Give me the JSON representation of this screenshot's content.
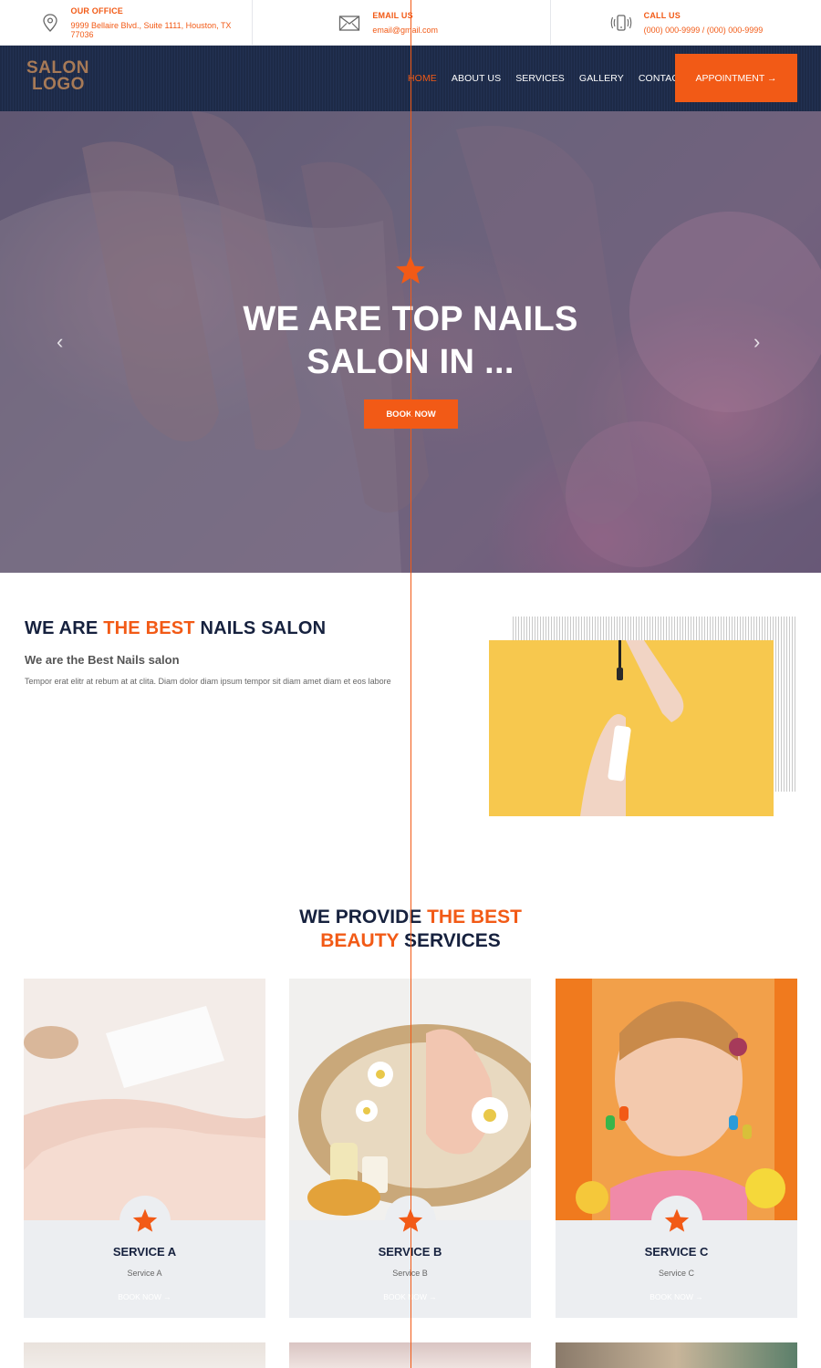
{
  "topbar": {
    "office": {
      "label": "OUR OFFICE",
      "value": "9999 Bellaire Blvd., Suite 1111, Houston, TX 77036",
      "icon": "location-pin-icon"
    },
    "email": {
      "label": "EMAIL US",
      "value": "email@gmail.com",
      "icon": "envelope-icon"
    },
    "call": {
      "label": "CALL US",
      "value": "(000) 000-9999 / (000) 000-9999",
      "icon": "phone-icon"
    }
  },
  "logo": {
    "line1": "SALON",
    "line2": "LOGO"
  },
  "nav": {
    "items": [
      {
        "label": "HOME",
        "active": true
      },
      {
        "label": "ABOUT US"
      },
      {
        "label": "SERVICES"
      },
      {
        "label": "GALLERY"
      },
      {
        "label": "CONTACTS"
      }
    ],
    "appointment_label": "APPOINTMENT →"
  },
  "hero": {
    "line1": "WE ARE TOP NAILS",
    "line2": "SALON IN ...",
    "button": "BOOK NOW",
    "prev": "‹",
    "next": "›"
  },
  "about": {
    "title_a": "WE ARE ",
    "title_hl": "THE BEST",
    "title_b": " NAILS SALON",
    "subtitle": "We are the Best Nails salon",
    "text": "Tempor erat elitr at rebum at at clita. Diam dolor diam ipsum tempor sit diam amet diam et eos labore"
  },
  "services": {
    "title_a": "WE PROVIDE ",
    "title_hl1": "THE BEST",
    "title_hl2": "BEAUTY",
    "title_b": " SERVICES",
    "cards": [
      {
        "name": "SERVICE A",
        "desc": "Service A",
        "link": "BOOK NOW →"
      },
      {
        "name": "SERVICE B",
        "desc": "Service B",
        "link": "BOOK NOW →"
      },
      {
        "name": "SERVICE C",
        "desc": "Service C",
        "link": "BOOK NOW →"
      }
    ]
  },
  "colors": {
    "accent": "#f25a16",
    "navy": "#1d2a47",
    "card_bg": "#eceef1"
  }
}
